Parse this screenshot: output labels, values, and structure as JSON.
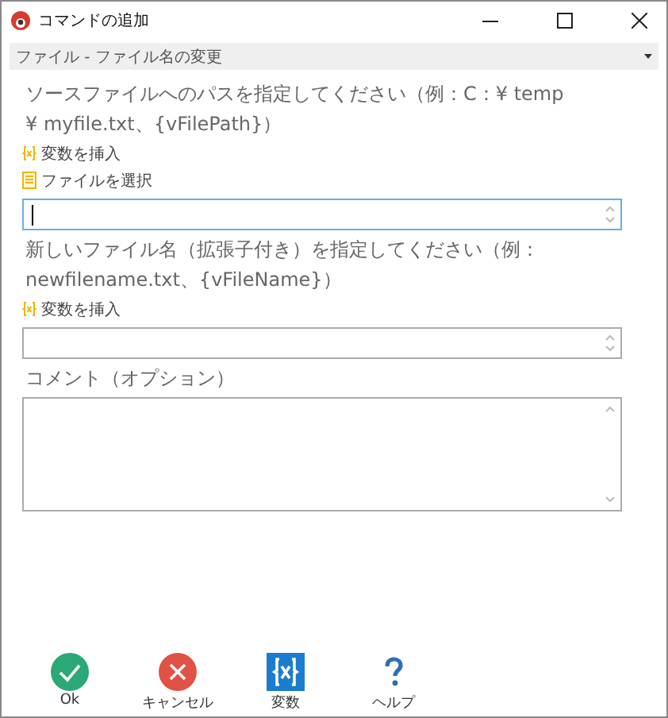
{
  "window": {
    "title": "コマンドの追加"
  },
  "action_select": {
    "value": "ファイル - ファイル名の変更"
  },
  "fields": [
    {
      "label": "ソースファイルへのパスを指定してください（例：C：¥ temp ¥ myfile.txt、{vFilePath}）",
      "links": [
        {
          "kind": "variable",
          "label": "変数を挿入"
        },
        {
          "kind": "file",
          "label": "ファイルを選択"
        }
      ],
      "focused": true,
      "multiline": false
    },
    {
      "label": "新しいファイル名（拡張子付き）を指定してください（例：newfilename.txt、{vFileName}）",
      "links": [
        {
          "kind": "variable",
          "label": "変数を挿入"
        }
      ],
      "focused": false,
      "multiline": false
    },
    {
      "label": "コメント（オプション）",
      "focused": false,
      "multiline": true
    }
  ],
  "buttons": [
    {
      "kind": "ok",
      "label": "Ok"
    },
    {
      "kind": "cancel",
      "label": "キャンセル"
    },
    {
      "kind": "variables",
      "label": "変数"
    },
    {
      "kind": "help",
      "label": "ヘルプ"
    }
  ]
}
